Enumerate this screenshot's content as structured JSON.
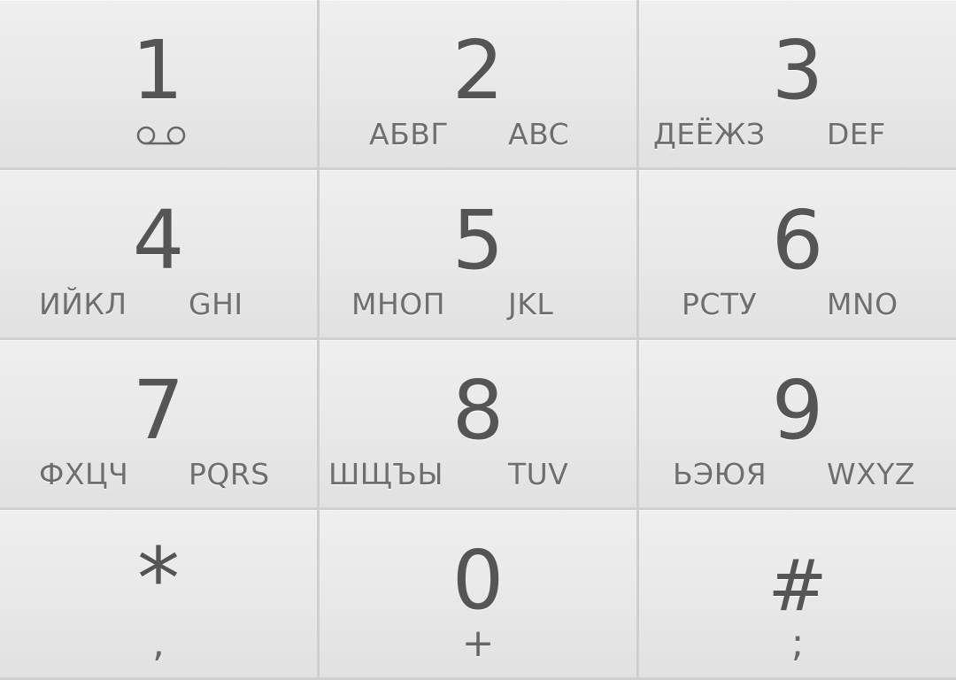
{
  "keys": [
    {
      "digit": "1",
      "cyrillic": "",
      "latin": "",
      "sub": "",
      "icon": "voicemail-icon"
    },
    {
      "digit": "2",
      "cyrillic": "АБВГ",
      "latin": "ABC",
      "sub": ""
    },
    {
      "digit": "3",
      "cyrillic": "ДЕЁЖЗ",
      "latin": "DEF",
      "sub": ""
    },
    {
      "digit": "4",
      "cyrillic": "ИЙКЛ",
      "latin": "GHI",
      "sub": ""
    },
    {
      "digit": "5",
      "cyrillic": "МНОП",
      "latin": "JKL",
      "sub": ""
    },
    {
      "digit": "6",
      "cyrillic": "РСТУ",
      "latin": "MNO",
      "sub": ""
    },
    {
      "digit": "7",
      "cyrillic": "ФХЦЧ",
      "latin": "PQRS",
      "sub": ""
    },
    {
      "digit": "8",
      "cyrillic": "ШЩЪЫ",
      "latin": "TUV",
      "sub": ""
    },
    {
      "digit": "9",
      "cyrillic": "ЬЭЮЯ",
      "latin": "WXYZ",
      "sub": ""
    },
    {
      "digit": "*",
      "cyrillic": "",
      "latin": "",
      "sub": ","
    },
    {
      "digit": "0",
      "cyrillic": "",
      "latin": "",
      "sub": "+"
    },
    {
      "digit": "#",
      "cyrillic": "",
      "latin": "",
      "sub": ";"
    }
  ],
  "colors": {
    "key_background": "#e8e8e8",
    "separator": "#cfcfcf",
    "digit_text": "#555555",
    "letter_text": "#6e6e6e"
  }
}
